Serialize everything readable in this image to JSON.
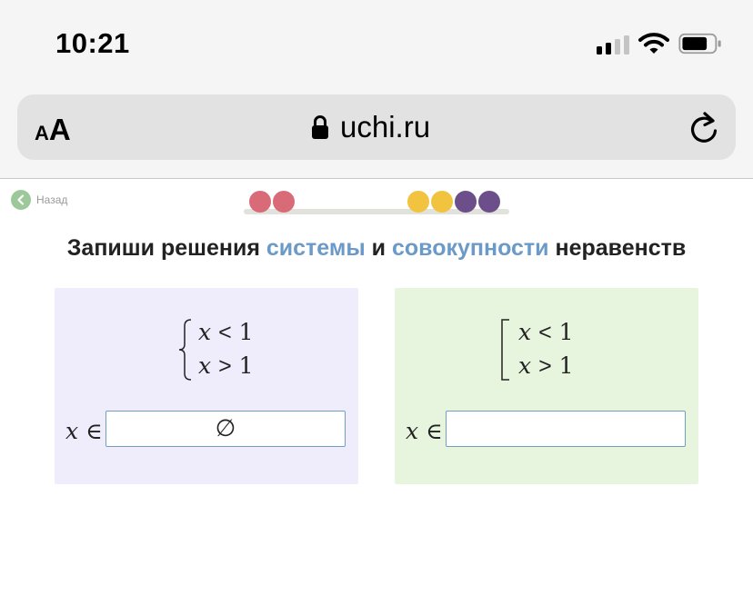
{
  "status_bar": {
    "time": "10:21",
    "signal_bars_active": 2,
    "signal_bars_total": 4
  },
  "browser": {
    "text_size_small": "A",
    "text_size_big": "A",
    "url": "uchi.ru",
    "icons": [
      "lock-icon",
      "reload-icon",
      "wifi-icon",
      "battery-icon",
      "signal-icon"
    ]
  },
  "nav": {
    "back_label": "Назад"
  },
  "progress": {
    "dots": [
      {
        "color": "#d96a78"
      },
      {
        "color": "#d96a78"
      },
      {
        "color": "#f1c33f"
      },
      {
        "color": "#f1c33f"
      },
      {
        "color": "#6c4f8a"
      },
      {
        "color": "#6c4f8a"
      }
    ]
  },
  "task": {
    "title_before": "Запиши решения ",
    "title_word1": "системы",
    "title_middle": " и ",
    "title_word2": "совокупности",
    "title_after": " неравенств"
  },
  "system_card": {
    "lines": [
      {
        "var": "x",
        "op": "<",
        "num": "1"
      },
      {
        "var": "x",
        "op": ">",
        "num": "1"
      }
    ],
    "answer_var": "x",
    "answer_symbol": "∈",
    "answer_value": "∅"
  },
  "union_card": {
    "lines": [
      {
        "var": "x",
        "op": "<",
        "num": "1"
      },
      {
        "var": "x",
        "op": ">",
        "num": "1"
      }
    ],
    "answer_var": "x",
    "answer_symbol": "∈",
    "answer_value": ""
  },
  "colors": {
    "accent_blue": "#6b9ac8",
    "system_bg": "#efedfc",
    "union_bg": "#e8f5de",
    "input_border": "#6fa0c2"
  }
}
